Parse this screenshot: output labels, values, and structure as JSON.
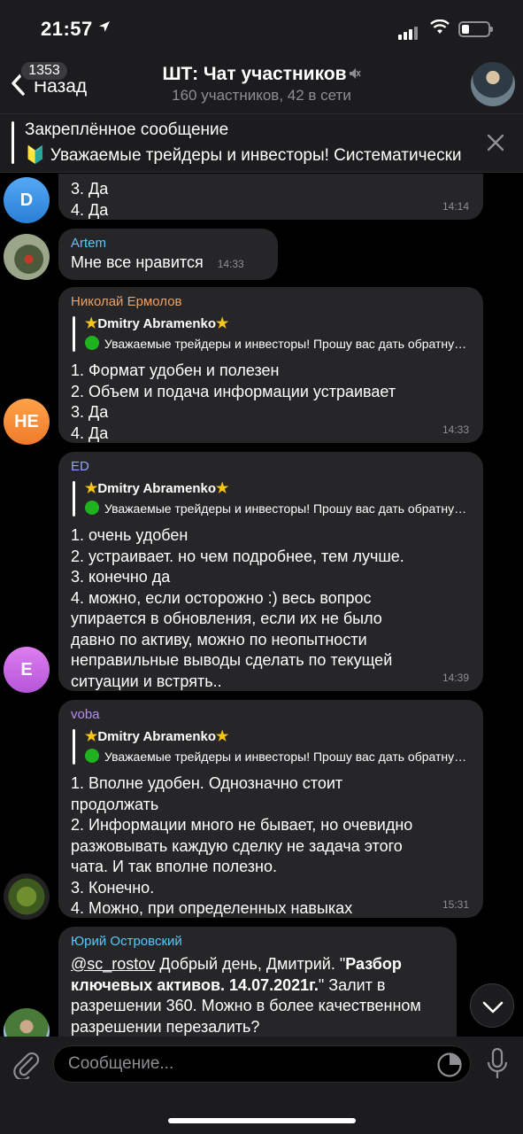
{
  "status_bar": {
    "time": "21:57"
  },
  "header": {
    "back_label": "Назад",
    "unread_badge": "1353",
    "title": "ШТ: Чат участников",
    "subtitle": "160 участников, 42 в сети"
  },
  "pinned": {
    "title": "Закреплённое сообщение",
    "text": "🔰 Уважаемые трейдеры и инвесторы! Систематически"
  },
  "messages": [
    {
      "avatar": "D",
      "avatar_color": "#3a8fe8",
      "lines": [
        "3. Да",
        "4. Да"
      ],
      "time": "14:14"
    },
    {
      "sender": "Artem",
      "sender_color": "#5ac8fa",
      "text": "Мне все нравится",
      "time": "14:33"
    },
    {
      "avatar": "НЕ",
      "avatar_color": "#f59b3b",
      "sender": "Николай Ермолов",
      "sender_color": "#f0a060",
      "reply_name": "Dmitry Abramenko",
      "reply_text": "Уважаемые трейдеры и инвесторы! Прошу вас дать обратную связь",
      "lines": [
        "1. Формат удобен и полезен",
        "2. Объем и подача информации устраивает",
        "3. Да",
        "4. Да"
      ],
      "time": "14:33"
    },
    {
      "avatar": "E",
      "avatar_color": "#c86ee0",
      "sender": "ED",
      "sender_color": "#8ea4ff",
      "reply_name": "Dmitry Abramenko",
      "reply_text": "Уважаемые трейдеры и инвесторы! Прошу вас дать обратную связь",
      "lines": [
        "1. очень удобен",
        "2. устраивает. но чем подробнее, тем лучше.",
        "3. конечно да",
        "4. можно, если осторожно :) весь вопрос",
        "упирается в обновления, если их не было",
        "давно по активу, можно по неопытности",
        "неправильные выводы сделать по текущей",
        "ситуации и встрять.."
      ],
      "time": "14:39"
    },
    {
      "sender": "voba",
      "sender_color": "#b48ef0",
      "reply_name": "Dmitry Abramenko",
      "reply_text": "Уважаемые трейдеры и инвесторы! Прошу вас дать обратную связь",
      "lines": [
        "1. Вполне удобен. Однозначно стоит",
        "продолжать",
        "2. Информации много не бывает, но очевидно",
        "разжовывать каждую сделку не задача этого",
        "чата. И так вполне полезно.",
        "3. Конечно.",
        "4. Можно, при определенных навыках"
      ],
      "time": "15:31"
    },
    {
      "sender": "Юрий Островский",
      "sender_color": "#5ac8fa",
      "mention": "@sc_rostov",
      "text_a": " Добрый день, Дмитрий. \"",
      "bold": "Разбор ключевых активов. 14.07.2021г.",
      "text_b": "\" Залит в разрешении 360. Можно в более качественном разрешении перезалить?"
    }
  ],
  "input": {
    "placeholder": "Сообщение..."
  }
}
